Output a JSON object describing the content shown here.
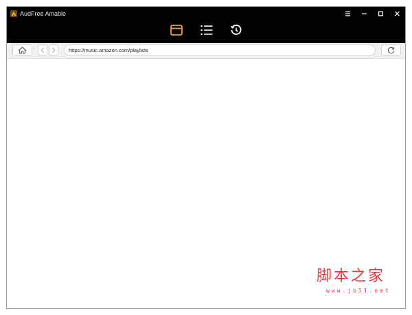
{
  "window": {
    "title": "AudFree Amable",
    "logo_icon": "audfree-logo-icon",
    "controls": [
      "menu-icon",
      "minimize-icon",
      "maximize-icon",
      "close-icon"
    ]
  },
  "nav": {
    "tabs": [
      {
        "id": "browser",
        "icon": "browser-window-icon",
        "active": true
      },
      {
        "id": "converting",
        "icon": "list-icon",
        "active": false
      },
      {
        "id": "history",
        "icon": "history-clock-icon",
        "active": false
      }
    ],
    "active_color": "#f39c21",
    "inactive_color": "#ffffff"
  },
  "toolbar": {
    "home_icon": "home-icon",
    "back_icon": "chevron-left-icon",
    "forward_icon": "chevron-right-icon",
    "url": "https://music.amazon.com/playlists",
    "refresh_icon": "refresh-icon"
  },
  "watermark": {
    "title": "脚本之家",
    "url": "www.jb51.net",
    "color": "#e8343d"
  },
  "colors": {
    "titlebar": "#020202",
    "toolbar": "#f1f1f1",
    "content": "#ffffff"
  }
}
